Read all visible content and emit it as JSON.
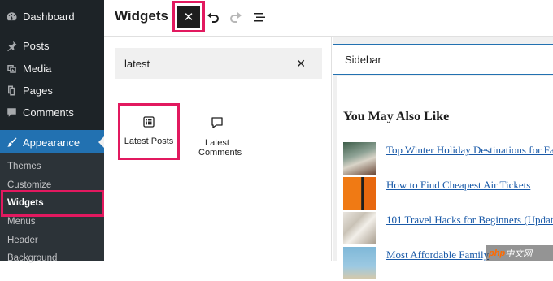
{
  "admin_menu": {
    "items": [
      {
        "label": "Dashboard",
        "icon": "dashboard-icon"
      },
      {
        "label": "Posts",
        "icon": "pin-icon"
      },
      {
        "label": "Media",
        "icon": "media-icon"
      },
      {
        "label": "Pages",
        "icon": "pages-icon"
      },
      {
        "label": "Comments",
        "icon": "comment-icon"
      },
      {
        "label": "Appearance",
        "icon": "brush-icon"
      }
    ],
    "submenu": [
      "Themes",
      "Customize",
      "Widgets",
      "Menus",
      "Header",
      "Background"
    ],
    "active_submenu": "Widgets",
    "active_color": "#2271b1"
  },
  "topbar": {
    "title": "Widgets",
    "close_icon": "close-icon",
    "undo_icon": "undo-icon",
    "redo_icon": "redo-icon",
    "list_view_icon": "list-view-icon"
  },
  "inserter": {
    "search_value": "latest",
    "blocks": [
      {
        "label": "Latest Posts",
        "icon": "post-list-icon"
      },
      {
        "label": "Latest Comments",
        "icon": "comment-bubble-icon"
      }
    ]
  },
  "preview": {
    "sidebar_title": "Sidebar",
    "widget_heading": "You May Also Like",
    "posts": [
      {
        "title": "Top Winter Holiday Destinations for Fa"
      },
      {
        "title": "How to Find Cheapest Air Tickets"
      },
      {
        "title": "101 Travel Hacks for Beginners (Updato"
      },
      {
        "title": "Most Affordable Family"
      }
    ]
  },
  "watermark": {
    "brand": "php",
    "suffix": "中文网"
  },
  "colors": {
    "highlight": "#e2195f",
    "link": "#1a5aa8",
    "sidebar_bg": "#1d2327"
  }
}
